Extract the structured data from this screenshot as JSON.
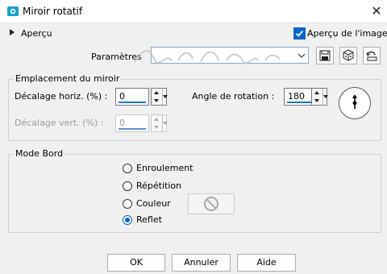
{
  "window": {
    "title": "Miroir rotatif",
    "close_glyph": "✕"
  },
  "preview": {
    "label": "Aperçu",
    "image_preview_label": "Aperçu de l'image",
    "image_preview_checked": true
  },
  "params": {
    "label": "Paramètres",
    "value": ""
  },
  "mirror_group": {
    "title": "Emplacement du miroir",
    "h_offset_label": "Décalage horiz. (%) :",
    "h_offset_value": "0",
    "v_offset_label": "Décalage vert. (%) :",
    "v_offset_value": "0",
    "rotation_label": "Angle de rotation :",
    "rotation_value": "180"
  },
  "edge_group": {
    "title": "Mode Bord",
    "options": [
      "Enroulement",
      "Répétition",
      "Couleur",
      "Reflet"
    ],
    "selected": "Reflet"
  },
  "buttons": {
    "ok": "OK",
    "cancel": "Annuler",
    "help": "Aide"
  },
  "colors": {
    "accent": "#0a64c8",
    "app_icon": "#1ba0c8"
  }
}
